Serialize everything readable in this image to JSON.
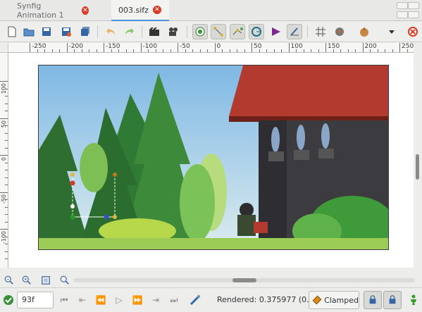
{
  "tabs": [
    {
      "label": "Synfig Animation 1",
      "active": false
    },
    {
      "label": "003.sifz",
      "active": true
    }
  ],
  "toolbar": {
    "buttons": [
      "new-icon",
      "open-icon",
      "save-icon",
      "save-as-icon",
      "save-all-icon",
      "undo-icon",
      "redo-icon",
      "render-icon",
      "preview-icon",
      "toggle-ducks-position-icon",
      "toggle-ducks-tangent-icon",
      "toggle-ducks-vertex-icon",
      "toggle-ducks-radius-icon",
      "toggle-ducks-width-icon",
      "toggle-ducks-angle-icon",
      "grid-icon",
      "snap-icon",
      "onion-skin-icon",
      "dropdown-icon",
      "close-document-icon"
    ]
  },
  "ruler": {
    "h_labels": [
      "-250",
      "-200",
      "-150",
      "-100",
      "-50",
      "0",
      "50",
      "100",
      "150",
      "200",
      "250"
    ],
    "v_labels": [
      "100",
      "50",
      "0",
      "-50",
      "-100"
    ]
  },
  "timebar": {
    "current_frame": "93f",
    "status": "Rendered: 0.375977 (0...",
    "interpolation": "Clamped"
  },
  "colors": {
    "accent": "#4a90d9",
    "close": "#d83a25",
    "sky_top": "#8ec3e6",
    "grass": "#9ccc55",
    "roof": "#b23a2e",
    "wall": "#3c3c40"
  }
}
